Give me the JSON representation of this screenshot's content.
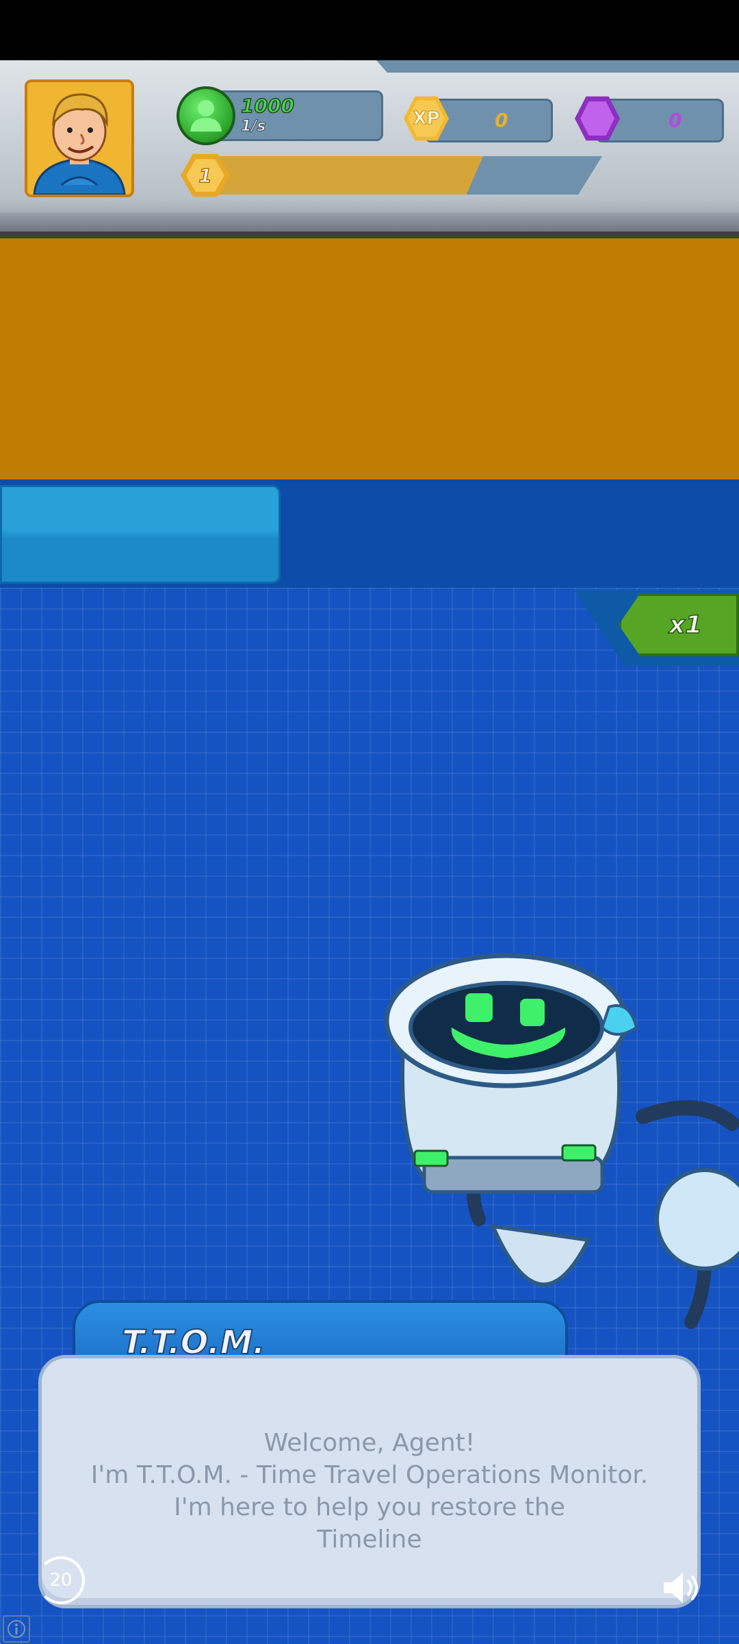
{
  "hud": {
    "coins": "1000",
    "coin_rate": "1/s",
    "xp_icon_label": "XP",
    "xp_value": "0",
    "gems_value": "0",
    "level": "1",
    "level_progress": 0.7
  },
  "speed": {
    "label": "x1"
  },
  "dialog": {
    "speaker": "T.T.O.M.",
    "line1": "Welcome, Agent!",
    "line2": "I'm T.T.O.M. - Time Travel Operations Monitor.",
    "line3": "I'm here to help you restore the",
    "line4": "Timeline"
  },
  "timer": {
    "value": "20"
  },
  "icons": {
    "avatar": "agent-portrait",
    "coin": "green-agent-coin-icon",
    "xp": "xp-hexagon-icon",
    "gem": "purple-gem-icon",
    "sound": "speaker-icon",
    "info": "info-icon"
  },
  "colors": {
    "background_blue": "#1553c2",
    "orange_panel": "#c17d03",
    "speed_green": "#56a524",
    "dialog_bg": "#d8e1f0"
  }
}
